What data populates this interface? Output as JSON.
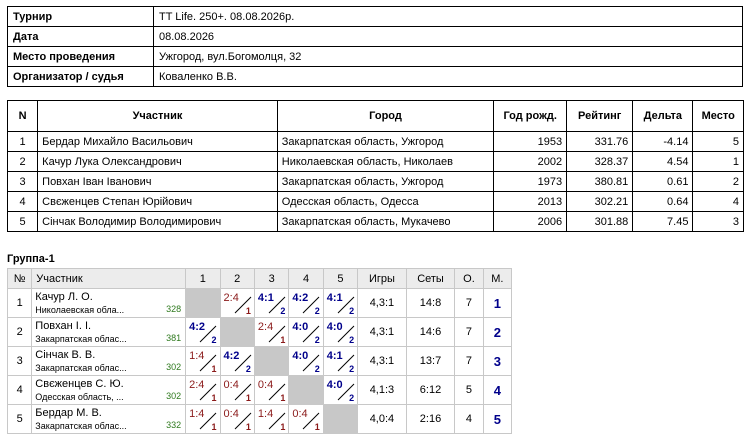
{
  "info": [
    {
      "label": "Турнир",
      "value": "TT Life. 250+. 08.08.2026р."
    },
    {
      "label": "Дата",
      "value": "08.08.2026"
    },
    {
      "label": "Место проведения",
      "value": "Ужгород, вул.Богомолця, 32"
    },
    {
      "label": "Организатор / судья",
      "value": "Коваленко В.В."
    }
  ],
  "participants": {
    "headers": [
      "N",
      "Участник",
      "Город",
      "Год рожд.",
      "Рейтинг",
      "Дельта",
      "Место"
    ],
    "rows": [
      {
        "n": "1",
        "name": "Бердар Михайло Васильович",
        "city": "Закарпатская область, Ужгород",
        "year": "1953",
        "rating": "331.76",
        "delta": "-4.14",
        "place": "5"
      },
      {
        "n": "2",
        "name": "Качур Лука Олександрович",
        "city": "Николаевская область, Николаев",
        "year": "2002",
        "rating": "328.37",
        "delta": "4.54",
        "place": "1"
      },
      {
        "n": "3",
        "name": "Повхан Іван Іванович",
        "city": "Закарпатская область, Ужгород",
        "year": "1973",
        "rating": "380.81",
        "delta": "0.61",
        "place": "2"
      },
      {
        "n": "4",
        "name": "Свєженцев Степан Юрійович",
        "city": "Одесская область, Одесса",
        "year": "2013",
        "rating": "302.21",
        "delta": "0.64",
        "place": "4"
      },
      {
        "n": "5",
        "name": "Сінчак Володимир Володимирович",
        "city": "Закарпатская область, Мукачево",
        "year": "2006",
        "rating": "301.88",
        "delta": "7.45",
        "place": "3"
      }
    ]
  },
  "group": {
    "title": "Группа-1",
    "headers": [
      "№",
      "Участник",
      "1",
      "2",
      "3",
      "4",
      "5",
      "Игры",
      "Сеты",
      "О.",
      "М."
    ],
    "rows": [
      {
        "n": "1",
        "name": "Качур Л. О.",
        "city": "Николаевская обла...",
        "rating": "328",
        "results": [
          null,
          {
            "s": "2:4",
            "sub": "1",
            "win": false
          },
          {
            "s": "4:1",
            "sub": "2",
            "win": true
          },
          {
            "s": "4:2",
            "sub": "2",
            "win": true
          },
          {
            "s": "4:1",
            "sub": "2",
            "win": true
          }
        ],
        "games": "4,3:1",
        "sets": "14:8",
        "points": "7",
        "place": "1"
      },
      {
        "n": "2",
        "name": "Повхан І. І.",
        "city": "Закарпатская облас...",
        "rating": "381",
        "results": [
          {
            "s": "4:2",
            "sub": "2",
            "win": true
          },
          null,
          {
            "s": "2:4",
            "sub": "1",
            "win": false
          },
          {
            "s": "4:0",
            "sub": "2",
            "win": true
          },
          {
            "s": "4:0",
            "sub": "2",
            "win": true
          }
        ],
        "games": "4,3:1",
        "sets": "14:6",
        "points": "7",
        "place": "2"
      },
      {
        "n": "3",
        "name": "Сінчак В. В.",
        "city": "Закарпатская облас...",
        "rating": "302",
        "results": [
          {
            "s": "1:4",
            "sub": "1",
            "win": false
          },
          {
            "s": "4:2",
            "sub": "2",
            "win": true
          },
          null,
          {
            "s": "4:0",
            "sub": "2",
            "win": true
          },
          {
            "s": "4:1",
            "sub": "2",
            "win": true
          }
        ],
        "games": "4,3:1",
        "sets": "13:7",
        "points": "7",
        "place": "3"
      },
      {
        "n": "4",
        "name": "Свєженцев С. Ю.",
        "city": "Одесская область, ...",
        "rating": "302",
        "results": [
          {
            "s": "2:4",
            "sub": "1",
            "win": false
          },
          {
            "s": "0:4",
            "sub": "1",
            "win": false
          },
          {
            "s": "0:4",
            "sub": "1",
            "win": false
          },
          null,
          {
            "s": "4:0",
            "sub": "2",
            "win": true
          }
        ],
        "games": "4,1:3",
        "sets": "6:12",
        "points": "5",
        "place": "4"
      },
      {
        "n": "5",
        "name": "Бердар М. В.",
        "city": "Закарпатская облас...",
        "rating": "332",
        "results": [
          {
            "s": "1:4",
            "sub": "1",
            "win": false
          },
          {
            "s": "0:4",
            "sub": "1",
            "win": false
          },
          {
            "s": "1:4",
            "sub": "1",
            "win": false
          },
          {
            "s": "0:4",
            "sub": "1",
            "win": false
          },
          null
        ],
        "games": "4,0:4",
        "sets": "2:16",
        "points": "4",
        "place": "5"
      }
    ]
  }
}
